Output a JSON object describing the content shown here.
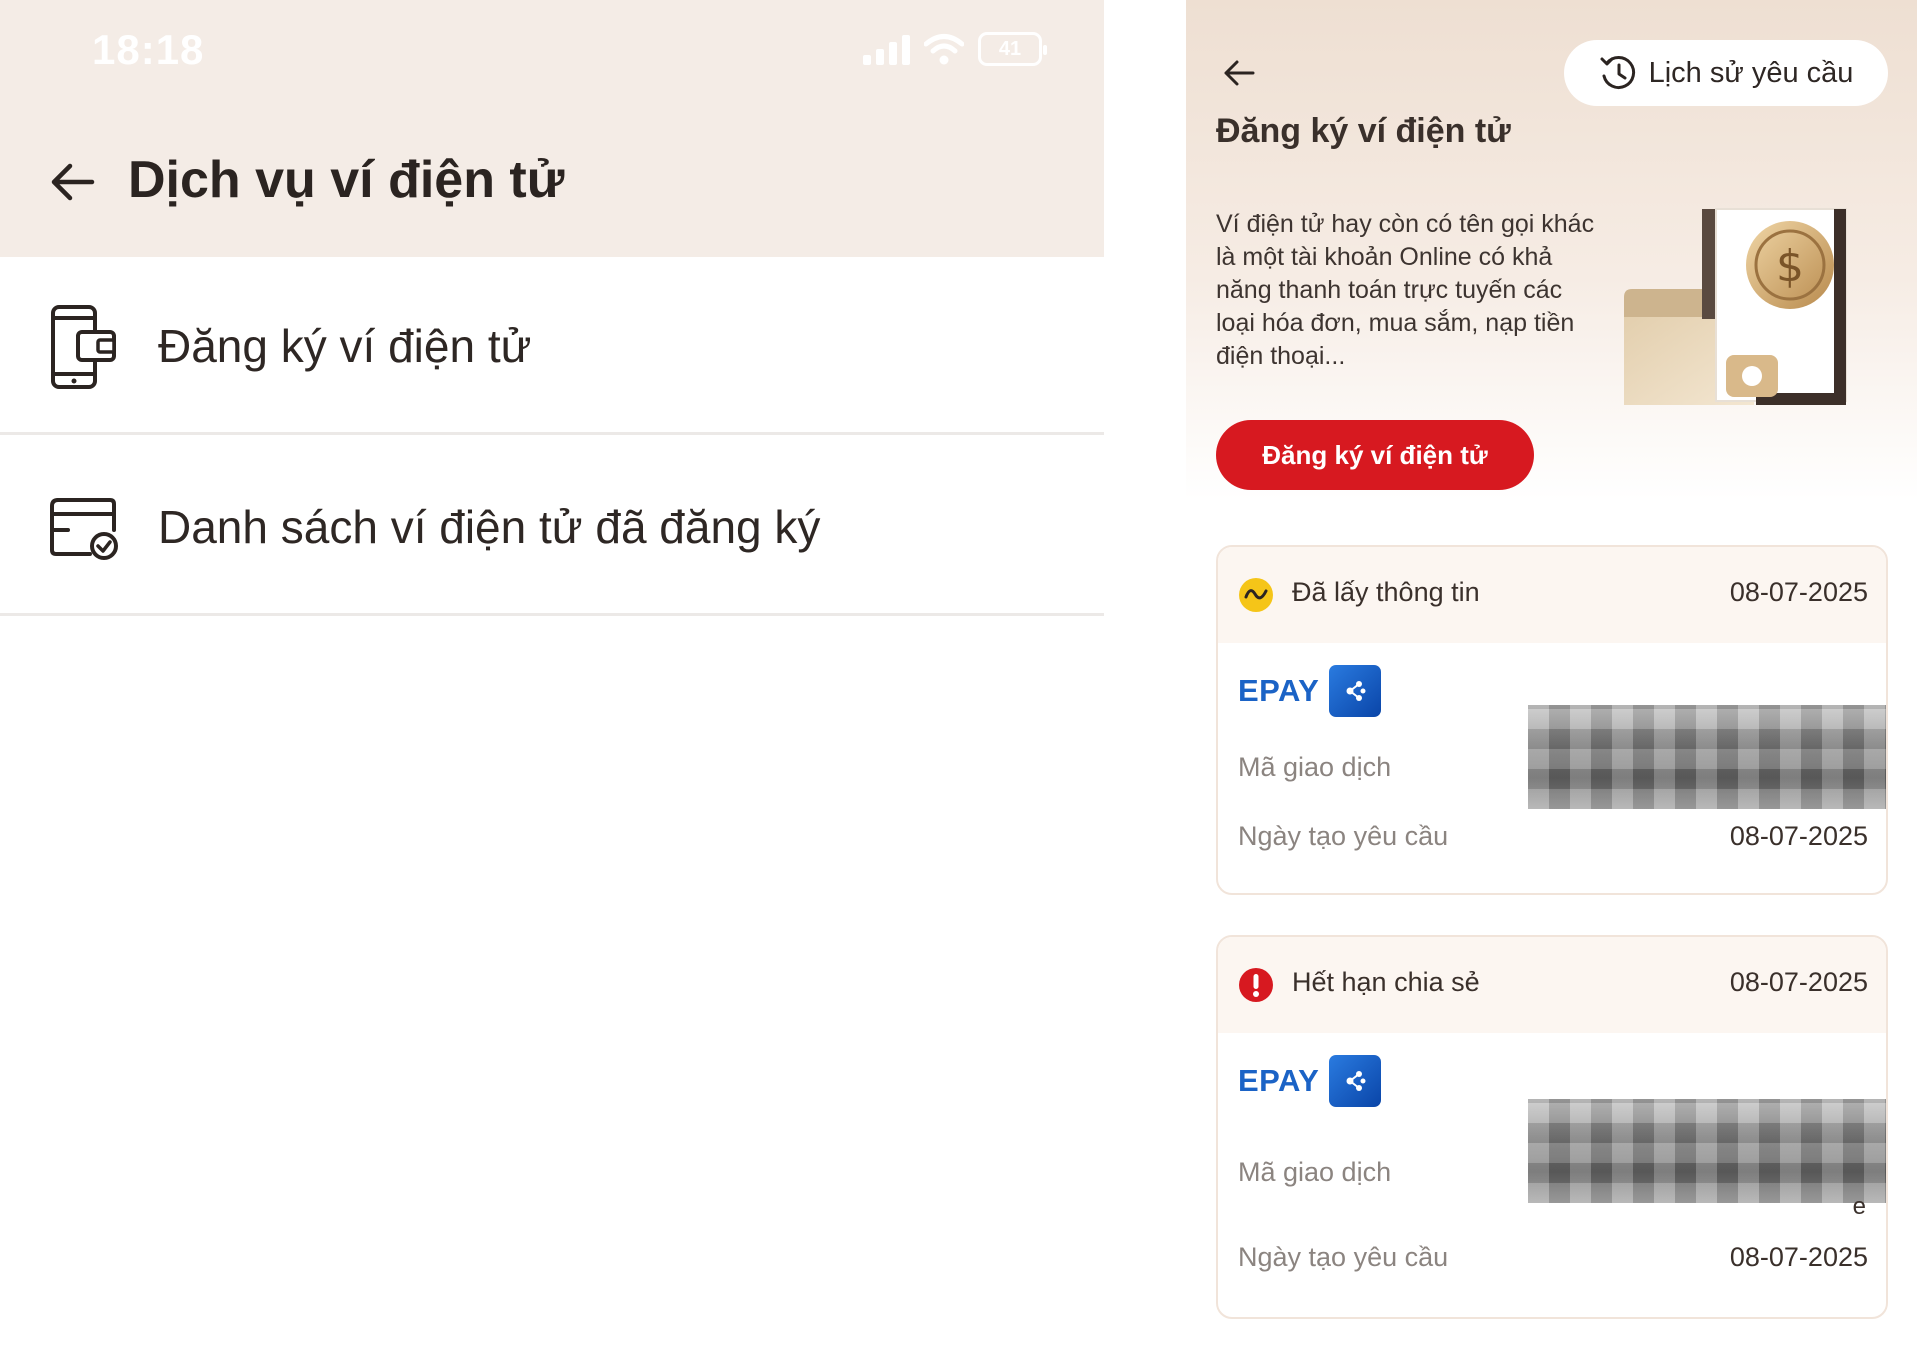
{
  "left": {
    "status_time": "18:18",
    "battery": "41",
    "title": "Dịch vụ ví điện tử",
    "menu": [
      {
        "label": "Đăng ký ví điện tử",
        "icon": "phone-wallet-icon"
      },
      {
        "label": "Danh sách ví điện tử đã đăng ký",
        "icon": "wallet-check-icon"
      }
    ]
  },
  "right": {
    "history_label": "Lịch sử yêu cầu",
    "title": "Đăng ký ví điện tử",
    "description": "Ví điện tử hay còn có tên gọi khác là một tài khoản Online có khả năng thanh toán trực tuyến các loại hóa đơn, mua sắm, nạp tiền điện thoại...",
    "register_button": "Đăng ký ví điện tử",
    "cards": [
      {
        "status": "Đã lấy thông tin",
        "status_icon": "pending-wave-icon",
        "date": "08-07-2025",
        "provider": "EPAY",
        "txn_label": "Mã giao dịch",
        "created_label": "Ngày tạo yêu cầu",
        "created_value": "08-07-2025"
      },
      {
        "status": "Hết hạn chia sẻ",
        "status_icon": "error-exclamation-icon",
        "date": "08-07-2025",
        "provider": "EPAY",
        "txn_label": "Mã giao dịch",
        "txn_fragment": "e",
        "created_label": "Ngày tạo yêu cầu",
        "created_value": "08-07-2025"
      }
    ]
  },
  "colors": {
    "header_bg": "#f4ece6",
    "brand_red": "#d71920",
    "epay_blue": "#1b63c6",
    "pending_yellow": "#f5c518"
  }
}
